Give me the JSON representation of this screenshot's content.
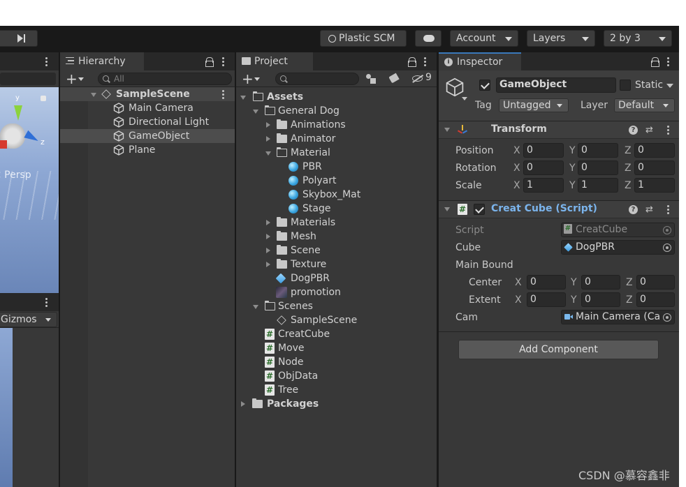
{
  "toolbar": {
    "plastic_scm": "Plastic SCM",
    "account": "Account",
    "layers": "Layers",
    "layout": "2 by 3"
  },
  "scene": {
    "persp_label": "< Persp",
    "gizmos": "Gizmos",
    "axis_y": "y",
    "axis_z": "z"
  },
  "hierarchy": {
    "tab": "Hierarchy",
    "search_placeholder": "All",
    "scene_name": "SampleScene",
    "items": [
      "Main Camera",
      "Directional Light",
      "GameObject",
      "Plane"
    ]
  },
  "project": {
    "tab": "Project",
    "hidden_count": "9",
    "assets": "Assets",
    "general_dog": "General Dog",
    "animations": "Animations",
    "animator": "Animator",
    "material": "Material",
    "materials_list": [
      "PBR",
      "Polyart",
      "Skybox_Mat",
      "Stage"
    ],
    "materials": "Materials",
    "mesh": "Mesh",
    "scene": "Scene",
    "texture": "Texture",
    "dogpbr": "DogPBR",
    "promotion": "promotion",
    "scenes": "Scenes",
    "sample_scene": "SampleScene",
    "scripts": [
      "CreatCube",
      "Move",
      "Node",
      "ObjData",
      "Tree"
    ],
    "packages": "Packages"
  },
  "inspector": {
    "tab": "Inspector",
    "object_name": "GameObject",
    "static_label": "Static",
    "tag_label": "Tag",
    "tag_value": "Untagged",
    "layer_label": "Layer",
    "layer_value": "Default",
    "transform": {
      "title": "Transform",
      "position_label": "Position",
      "rotation_label": "Rotation",
      "scale_label": "Scale",
      "position": [
        "0",
        "0",
        "0"
      ],
      "rotation": [
        "0",
        "0",
        "0"
      ],
      "scale": [
        "1",
        "1",
        "1"
      ]
    },
    "script_component": {
      "title": "Creat Cube (Script)",
      "script_label": "Script",
      "script_value": "CreatCube",
      "cube_label": "Cube",
      "cube_value": "DogPBR",
      "main_bound_label": "Main Bound",
      "center_label": "Center",
      "center": [
        "0",
        "0",
        "0"
      ],
      "extent_label": "Extent",
      "extent": [
        "0",
        "0",
        "0"
      ],
      "cam_label": "Cam",
      "cam_value": "Main Camera (Ca"
    },
    "add_component": "Add Component",
    "axis_labels": [
      "X",
      "Y",
      "Z"
    ]
  },
  "watermark": "CSDN @慕容鑫非"
}
